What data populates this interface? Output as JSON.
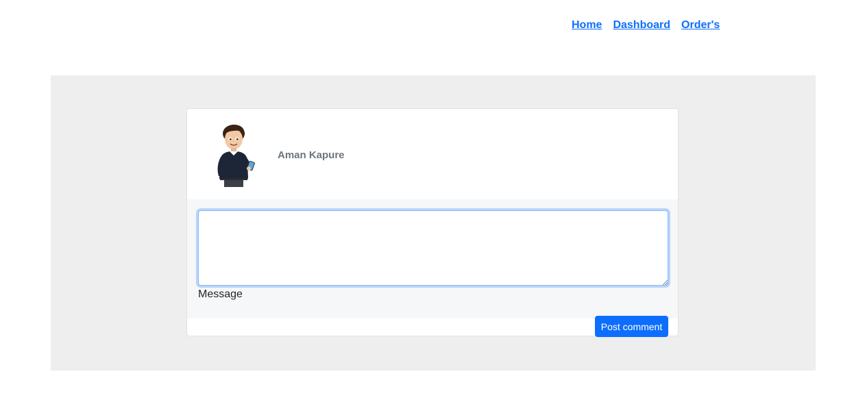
{
  "nav": {
    "items": [
      {
        "label": "Home"
      },
      {
        "label": "Dashboard"
      },
      {
        "label": "Order's"
      }
    ]
  },
  "comment_card": {
    "user_name": "Aman Kapure",
    "avatar_icon": "cartoon-man-avatar",
    "message_value": "",
    "message_label": "Message",
    "submit_label": "Post comment"
  },
  "colors": {
    "link": "#0d6efd",
    "button": "#0d6efd",
    "section_bg": "#eeeeee",
    "name_text": "#6c757d"
  }
}
